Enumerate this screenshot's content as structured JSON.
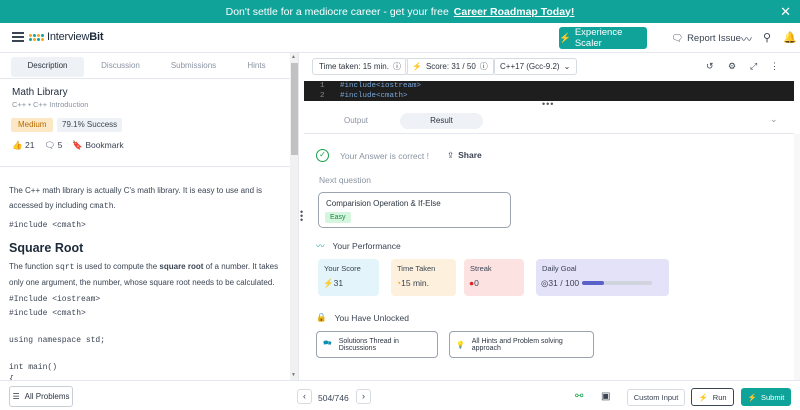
{
  "banner": {
    "text": "Don't settle for a mediocre career - get your free",
    "link": "Career Roadmap Today!",
    "close": "✕"
  },
  "nav": {
    "logo_prefix": "Interview",
    "logo_suffix": "Bit",
    "experience_btn": "Experience Scaler",
    "report_issue": "Report Issue"
  },
  "left": {
    "tabs": [
      "Description",
      "Discussion",
      "Submissions",
      "Hints"
    ],
    "problem_title": "Math Library",
    "breadcrumb": "C++ • C++ Introduction",
    "difficulty": "Medium",
    "success": "79.1% Success",
    "likes": "21",
    "comments": "5",
    "bookmark": "Bookmark",
    "intro_1": "The C++ math library is actually C's math library. It is easy to use and is",
    "intro_2a": "accessed by including ",
    "intro_2b": "cmath",
    "intro_2c": ".",
    "code_include": "#include <cmath>",
    "heading": "Square Root",
    "para_1a": "The function ",
    "para_1b": "sqrt",
    "para_1c": " is used to compute the ",
    "para_1d": "square root",
    "para_1e": " of a number. It takes",
    "para_2": "only one argument, the number, whose square root needs to be calculated.",
    "code_lines": [
      "#Include <iostream>",
      "#include <cmath>",
      "",
      "using namespace std;",
      "",
      "int main()",
      "{"
    ]
  },
  "right": {
    "time_taken": "Time taken: 15 min.",
    "score": "Score: 31 / 50",
    "language": "C++17 (Gcc-9.2)",
    "editor_lines": [
      {
        "n": "1",
        "code": "#include<iostream>"
      },
      {
        "n": "2",
        "code": "#include<cmath>"
      }
    ],
    "output_tab": "Output",
    "result_tab": "Result",
    "correct": "Your Answer is correct !",
    "share": "Share",
    "next_question": "Next question",
    "next_title": "Comparision Operation & If-Else",
    "next_level": "Easy",
    "performance": "Your Performance",
    "cards": {
      "score": {
        "label": "Your Score",
        "value": "31"
      },
      "time": {
        "label": "Time Taken",
        "value": "15 min."
      },
      "streak": {
        "label": "Streak",
        "value": "0"
      },
      "goal": {
        "label": "Daily Goal",
        "value": "31 / 100",
        "progress": 0.31
      }
    },
    "unlocked": "You Have Unlocked",
    "unlock_1": "Solutions Thread in Discussions",
    "unlock_2": "All Hints and Problem solving approach"
  },
  "bottom": {
    "all_problems": "All Problems",
    "pager": "504/746",
    "custom_input": "Custom Input",
    "run": "Run",
    "submit": "Submit"
  },
  "colors": {
    "brand": "#0fa39a",
    "medium_bg": "#fde8c6",
    "score_card": "#e3f4fb",
    "time_card": "#fdf0dc",
    "streak_card": "#fde2e2",
    "goal_card": "#e4e2f8"
  }
}
